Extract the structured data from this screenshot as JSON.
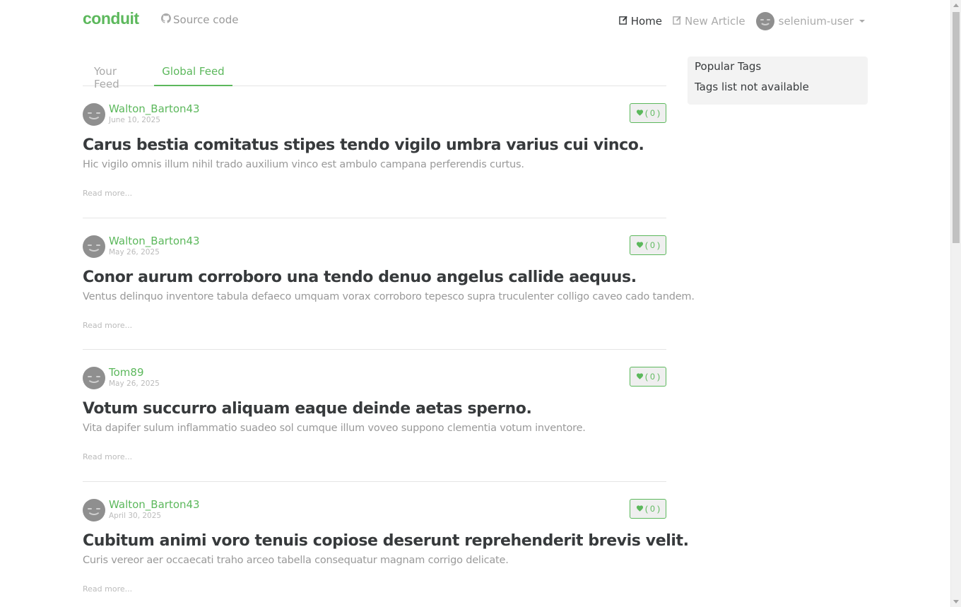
{
  "navbar": {
    "brand": "conduit",
    "source_label": "Source code",
    "home_label": "Home",
    "new_article_label": "New Article",
    "username": "selenium-user"
  },
  "tabs": {
    "your_feed": "Your Feed",
    "global_feed": "Global Feed"
  },
  "articles": [
    {
      "author": "Walton_Barton43",
      "date": "June 10, 2025",
      "favorites": "( 0 )",
      "title": "Carus bestia comitatus stipes tendo vigilo umbra varius cui vinco.",
      "description": "Hic vigilo omnis illum nihil trado auxilium vinco est ambulo campana perferendis curtus.",
      "read_more": "Read more..."
    },
    {
      "author": "Walton_Barton43",
      "date": "May 26, 2025",
      "favorites": "( 0 )",
      "title": "Conor aurum corroboro una tendo denuo angelus callide aequus.",
      "description": "Ventus delinquo inventore tabula defaeco umquam vorax corroboro tepesco supra truculenter colligo caveo cado tandem.",
      "read_more": "Read more..."
    },
    {
      "author": "Tom89",
      "date": "May 26, 2025",
      "favorites": "( 0 )",
      "title": "Votum succurro aliquam eaque deinde aetas sperno.",
      "description": "Vita dapifer sulum inflammatio suadeo sol cumque illum voveo suppono clementia votum inventore.",
      "read_more": "Read more..."
    },
    {
      "author": "Walton_Barton43",
      "date": "April 30, 2025",
      "favorites": "( 0 )",
      "title": "Cubitum animi voro tenuis copiose deserunt reprehenderit brevis velit.",
      "description": "Curis vereor aer occaecati traho arceo tabella consequatur magnam corrigo delicate.",
      "read_more": "Read more..."
    }
  ],
  "sidebar": {
    "heading": "Popular Tags",
    "empty_message": "Tags list not available"
  },
  "colors": {
    "accent": "#5cb85c",
    "text": "#373a3c",
    "muted": "#999999"
  }
}
